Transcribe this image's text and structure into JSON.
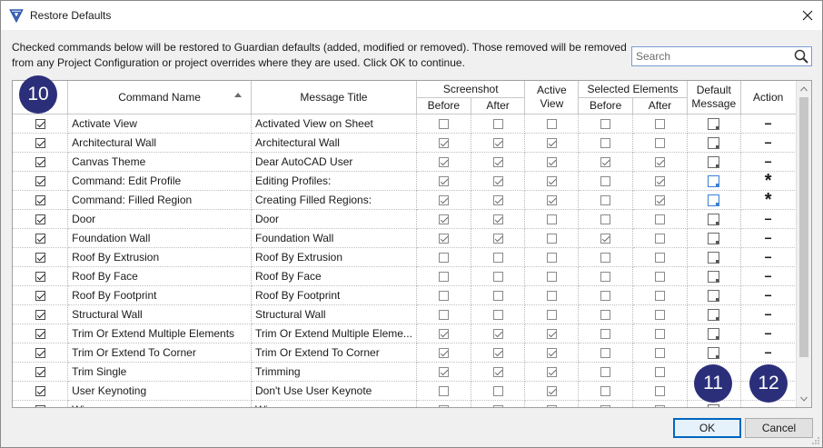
{
  "window": {
    "title": "Restore Defaults",
    "app_icon": "guardian-shield-icon",
    "close_icon": "close-icon"
  },
  "description": "Checked commands below will be restored to Guardian defaults (added, modified or removed). Those removed will be removed from any Project Configuration or project overrides where they are used. Click OK to continue.",
  "search": {
    "placeholder": "Search",
    "value": ""
  },
  "grid": {
    "headers": {
      "command_name": "Command Name",
      "message_title": "Message Title",
      "screenshot": "Screenshot",
      "active_view": "Active View",
      "selected_elements": "Selected Elements",
      "default_message": "Default Message",
      "action": "Action",
      "before": "Before",
      "after": "After"
    },
    "sorted_column": "command_name",
    "rows": [
      {
        "checked": true,
        "command": "Activate View",
        "title": "Activated View on Sheet",
        "ss_before": false,
        "ss_after": false,
        "active_view": false,
        "sel_before": false,
        "sel_after": false,
        "msg_icon": "default",
        "action": "−"
      },
      {
        "checked": true,
        "command": "Architectural Wall",
        "title": "Architectural Wall",
        "ss_before": true,
        "ss_after": true,
        "active_view": true,
        "sel_before": false,
        "sel_after": false,
        "msg_icon": "default",
        "action": "−"
      },
      {
        "checked": true,
        "command": "Canvas Theme",
        "title": "Dear AutoCAD User",
        "ss_before": true,
        "ss_after": true,
        "active_view": true,
        "sel_before": true,
        "sel_after": true,
        "msg_icon": "default",
        "action": "−"
      },
      {
        "checked": true,
        "command": "Command: Edit Profile",
        "title": "Editing Profiles:",
        "ss_before": true,
        "ss_after": true,
        "active_view": true,
        "sel_before": false,
        "sel_after": true,
        "msg_icon": "modified",
        "action": "*"
      },
      {
        "checked": true,
        "command": "Command: Filled Region",
        "title": "Creating Filled Regions:",
        "ss_before": true,
        "ss_after": true,
        "active_view": true,
        "sel_before": false,
        "sel_after": true,
        "msg_icon": "modified",
        "action": "*"
      },
      {
        "checked": true,
        "command": "Door",
        "title": "Door",
        "ss_before": true,
        "ss_after": true,
        "active_view": false,
        "sel_before": false,
        "sel_after": false,
        "msg_icon": "default",
        "action": "−"
      },
      {
        "checked": true,
        "command": "Foundation Wall",
        "title": "Foundation Wall",
        "ss_before": true,
        "ss_after": true,
        "active_view": false,
        "sel_before": true,
        "sel_after": false,
        "msg_icon": "default",
        "action": "−"
      },
      {
        "checked": true,
        "command": "Roof By Extrusion",
        "title": "Roof By Extrusion",
        "ss_before": false,
        "ss_after": false,
        "active_view": false,
        "sel_before": false,
        "sel_after": false,
        "msg_icon": "default",
        "action": "−"
      },
      {
        "checked": true,
        "command": "Roof By Face",
        "title": "Roof By Face",
        "ss_before": false,
        "ss_after": false,
        "active_view": false,
        "sel_before": false,
        "sel_after": false,
        "msg_icon": "default",
        "action": "−"
      },
      {
        "checked": true,
        "command": "Roof By Footprint",
        "title": "Roof By Footprint",
        "ss_before": false,
        "ss_after": false,
        "active_view": false,
        "sel_before": false,
        "sel_after": false,
        "msg_icon": "default",
        "action": "−"
      },
      {
        "checked": true,
        "command": "Structural Wall",
        "title": "Structural Wall",
        "ss_before": false,
        "ss_after": false,
        "active_view": false,
        "sel_before": false,
        "sel_after": false,
        "msg_icon": "default",
        "action": "−"
      },
      {
        "checked": true,
        "command": "Trim Or Extend Multiple Elements",
        "title": "Trim Or Extend Multiple Eleme...",
        "ss_before": true,
        "ss_after": true,
        "active_view": true,
        "sel_before": false,
        "sel_after": false,
        "msg_icon": "default",
        "action": "−"
      },
      {
        "checked": true,
        "command": "Trim Or Extend To Corner",
        "title": "Trim Or Extend To Corner",
        "ss_before": true,
        "ss_after": true,
        "active_view": true,
        "sel_before": false,
        "sel_after": false,
        "msg_icon": "default",
        "action": "−"
      },
      {
        "checked": true,
        "command": "Trim Single",
        "title": "Trimming",
        "ss_before": true,
        "ss_after": true,
        "active_view": true,
        "sel_before": false,
        "sel_after": false,
        "msg_icon": "default",
        "action": ""
      },
      {
        "checked": true,
        "command": "User Keynoting",
        "title": "Don't Use User Keynote",
        "ss_before": false,
        "ss_after": false,
        "active_view": true,
        "sel_before": false,
        "sel_after": false,
        "msg_icon": "default",
        "action": ""
      },
      {
        "checked": false,
        "command": "Wi...",
        "title": "Wi...",
        "ss_before": false,
        "ss_after": false,
        "active_view": false,
        "sel_before": false,
        "sel_after": false,
        "msg_icon": "default",
        "action": ""
      }
    ]
  },
  "badges": {
    "b10": "10",
    "b11": "11",
    "b12": "12"
  },
  "buttons": {
    "ok": "OK",
    "cancel": "Cancel"
  },
  "colors": {
    "accent": "#0067c0",
    "badge": "#2b2f7a",
    "modified": "#3a7fd5"
  }
}
